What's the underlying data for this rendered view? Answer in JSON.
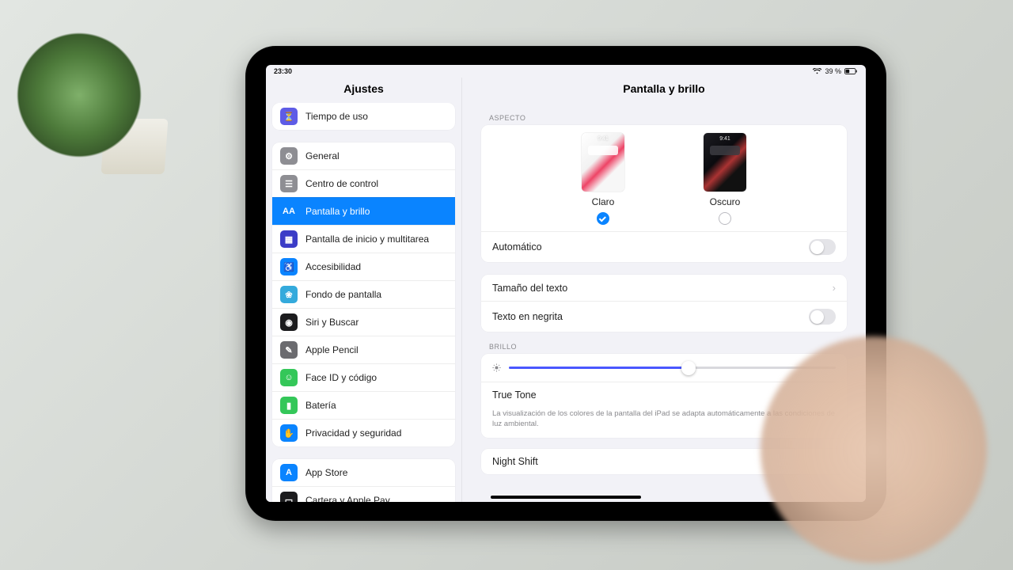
{
  "status": {
    "time": "23:30",
    "battery_text": "39 %"
  },
  "sidebar": {
    "title": "Ajustes",
    "groups": [
      {
        "items": [
          {
            "label": "Tiempo de uso",
            "icon_name": "screen-time-icon",
            "icon_bg": "#5e5ce6",
            "glyph": "⏳"
          }
        ]
      },
      {
        "items": [
          {
            "label": "General",
            "icon_name": "general-icon",
            "icon_bg": "#8e8e93",
            "glyph": "⚙"
          },
          {
            "label": "Centro de control",
            "icon_name": "control-center-icon",
            "icon_bg": "#8e8e93",
            "glyph": "☰"
          },
          {
            "label": "Pantalla y brillo",
            "icon_name": "display-icon",
            "icon_bg": "#0a84ff",
            "glyph": "AA",
            "selected": true
          },
          {
            "label": "Pantalla de inicio y multitarea",
            "icon_name": "home-screen-icon",
            "icon_bg": "#3b3cc7",
            "glyph": "▦"
          },
          {
            "label": "Accesibilidad",
            "icon_name": "accessibility-icon",
            "icon_bg": "#0a84ff",
            "glyph": "♿"
          },
          {
            "label": "Fondo de pantalla",
            "icon_name": "wallpaper-icon",
            "icon_bg": "#34aadc",
            "glyph": "❀"
          },
          {
            "label": "Siri y Buscar",
            "icon_name": "siri-icon",
            "icon_bg": "#1c1c1e",
            "glyph": "◉"
          },
          {
            "label": "Apple Pencil",
            "icon_name": "pencil-icon",
            "icon_bg": "#6b6b6f",
            "glyph": "✎"
          },
          {
            "label": "Face ID y código",
            "icon_name": "faceid-icon",
            "icon_bg": "#34c759",
            "glyph": "☺"
          },
          {
            "label": "Batería",
            "icon_name": "battery-icon",
            "icon_bg": "#34c759",
            "glyph": "▮"
          },
          {
            "label": "Privacidad y seguridad",
            "icon_name": "privacy-icon",
            "icon_bg": "#0a84ff",
            "glyph": "✋"
          }
        ]
      },
      {
        "items": [
          {
            "label": "App Store",
            "icon_name": "app-store-icon",
            "icon_bg": "#0a84ff",
            "glyph": "A"
          },
          {
            "label": "Cartera y Apple Pay",
            "icon_name": "wallet-icon",
            "icon_bg": "#1c1c1e",
            "glyph": "▭"
          }
        ]
      }
    ]
  },
  "main": {
    "title": "Pantalla y brillo",
    "aspect_header": "ASPECTO",
    "appearance": {
      "thumb_time": "9:41",
      "light": {
        "label": "Claro",
        "selected": true
      },
      "dark": {
        "label": "Oscuro",
        "selected": false
      }
    },
    "automatic_label": "Automático",
    "text_size_label": "Tamaño del texto",
    "bold_text_label": "Texto en negrita",
    "brightness_header": "BRILLO",
    "brightness_pct": 55,
    "true_tone_label": "True Tone",
    "true_tone_desc": "La visualización de los colores de la pantalla del iPad se adapta automáticamente a las condiciones de luz ambiental.",
    "night_shift_label": "Night Shift"
  }
}
